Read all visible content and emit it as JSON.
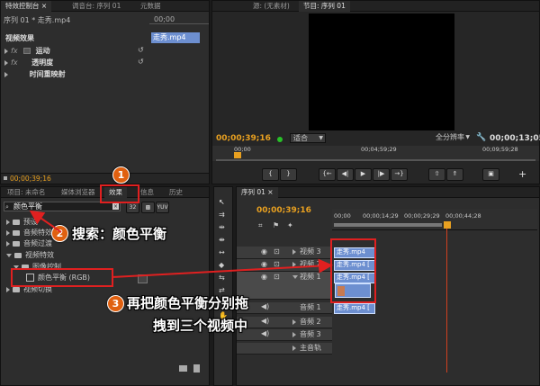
{
  "effect_controls": {
    "tabs": [
      "特效控制台 ×",
      "调音台: 序列 01",
      "元数据"
    ],
    "source": "序列 01 * 走秀.mp4",
    "ruler_time": "00;00",
    "clip_label": "走秀.mp4",
    "section": "视频效果",
    "effects": [
      "运动",
      "透明度",
      "时间重映射"
    ],
    "timecode": "00;00;39;16"
  },
  "program_monitor": {
    "tabs": [
      "源: (无素材)",
      "节目: 序列 01"
    ],
    "current_time": "00;00;39;16",
    "fit": "适合",
    "quality": "全分辨率",
    "duration": "00;00;13;05",
    "ruler": [
      "00;00",
      "00;04;59;29",
      "00;09;59;28"
    ]
  },
  "project_panel": {
    "tabs": [
      "项目: 未命名",
      "媒体浏览器",
      "效果",
      "信息",
      "历史"
    ],
    "search_value": "颜色平衡",
    "tree": [
      {
        "label": "预设",
        "indent": 0,
        "open": false
      },
      {
        "label": "音频特效",
        "indent": 0,
        "open": false
      },
      {
        "label": "音频过渡",
        "indent": 0,
        "open": false
      },
      {
        "label": "视频特效",
        "indent": 0,
        "open": true
      },
      {
        "label": "图像控制",
        "indent": 1,
        "open": true
      },
      {
        "label": "颜色平衡 (RGB)",
        "indent": 2,
        "open": false,
        "effect": true
      },
      {
        "label": "视频切换",
        "indent": 0,
        "open": false
      }
    ]
  },
  "timeline": {
    "tab": "序列 01 ×",
    "timecode": "00;00;39;16",
    "ruler": [
      "00;00",
      "00;00;14;29",
      "00;00;29;29",
      "00;00;44;28"
    ],
    "video_tracks": [
      "视频 3",
      "视频 2",
      "视频 1"
    ],
    "audio_tracks": [
      "音频 1",
      "音频 2",
      "音频 3",
      "主音轨"
    ],
    "clips": {
      "v3": "走秀.mp4",
      "v2": "走秀.mp4 [",
      "v1": "走秀.mp4 [",
      "a1": "走秀.mp4 ["
    }
  },
  "annotations": {
    "step1": "1",
    "step2": "2",
    "step2_text": "搜索：颜色平衡",
    "step3": "3",
    "step3_text_line1": "再把颜色平衡分别拖",
    "step3_text_line2": "拽到三个视频中"
  }
}
